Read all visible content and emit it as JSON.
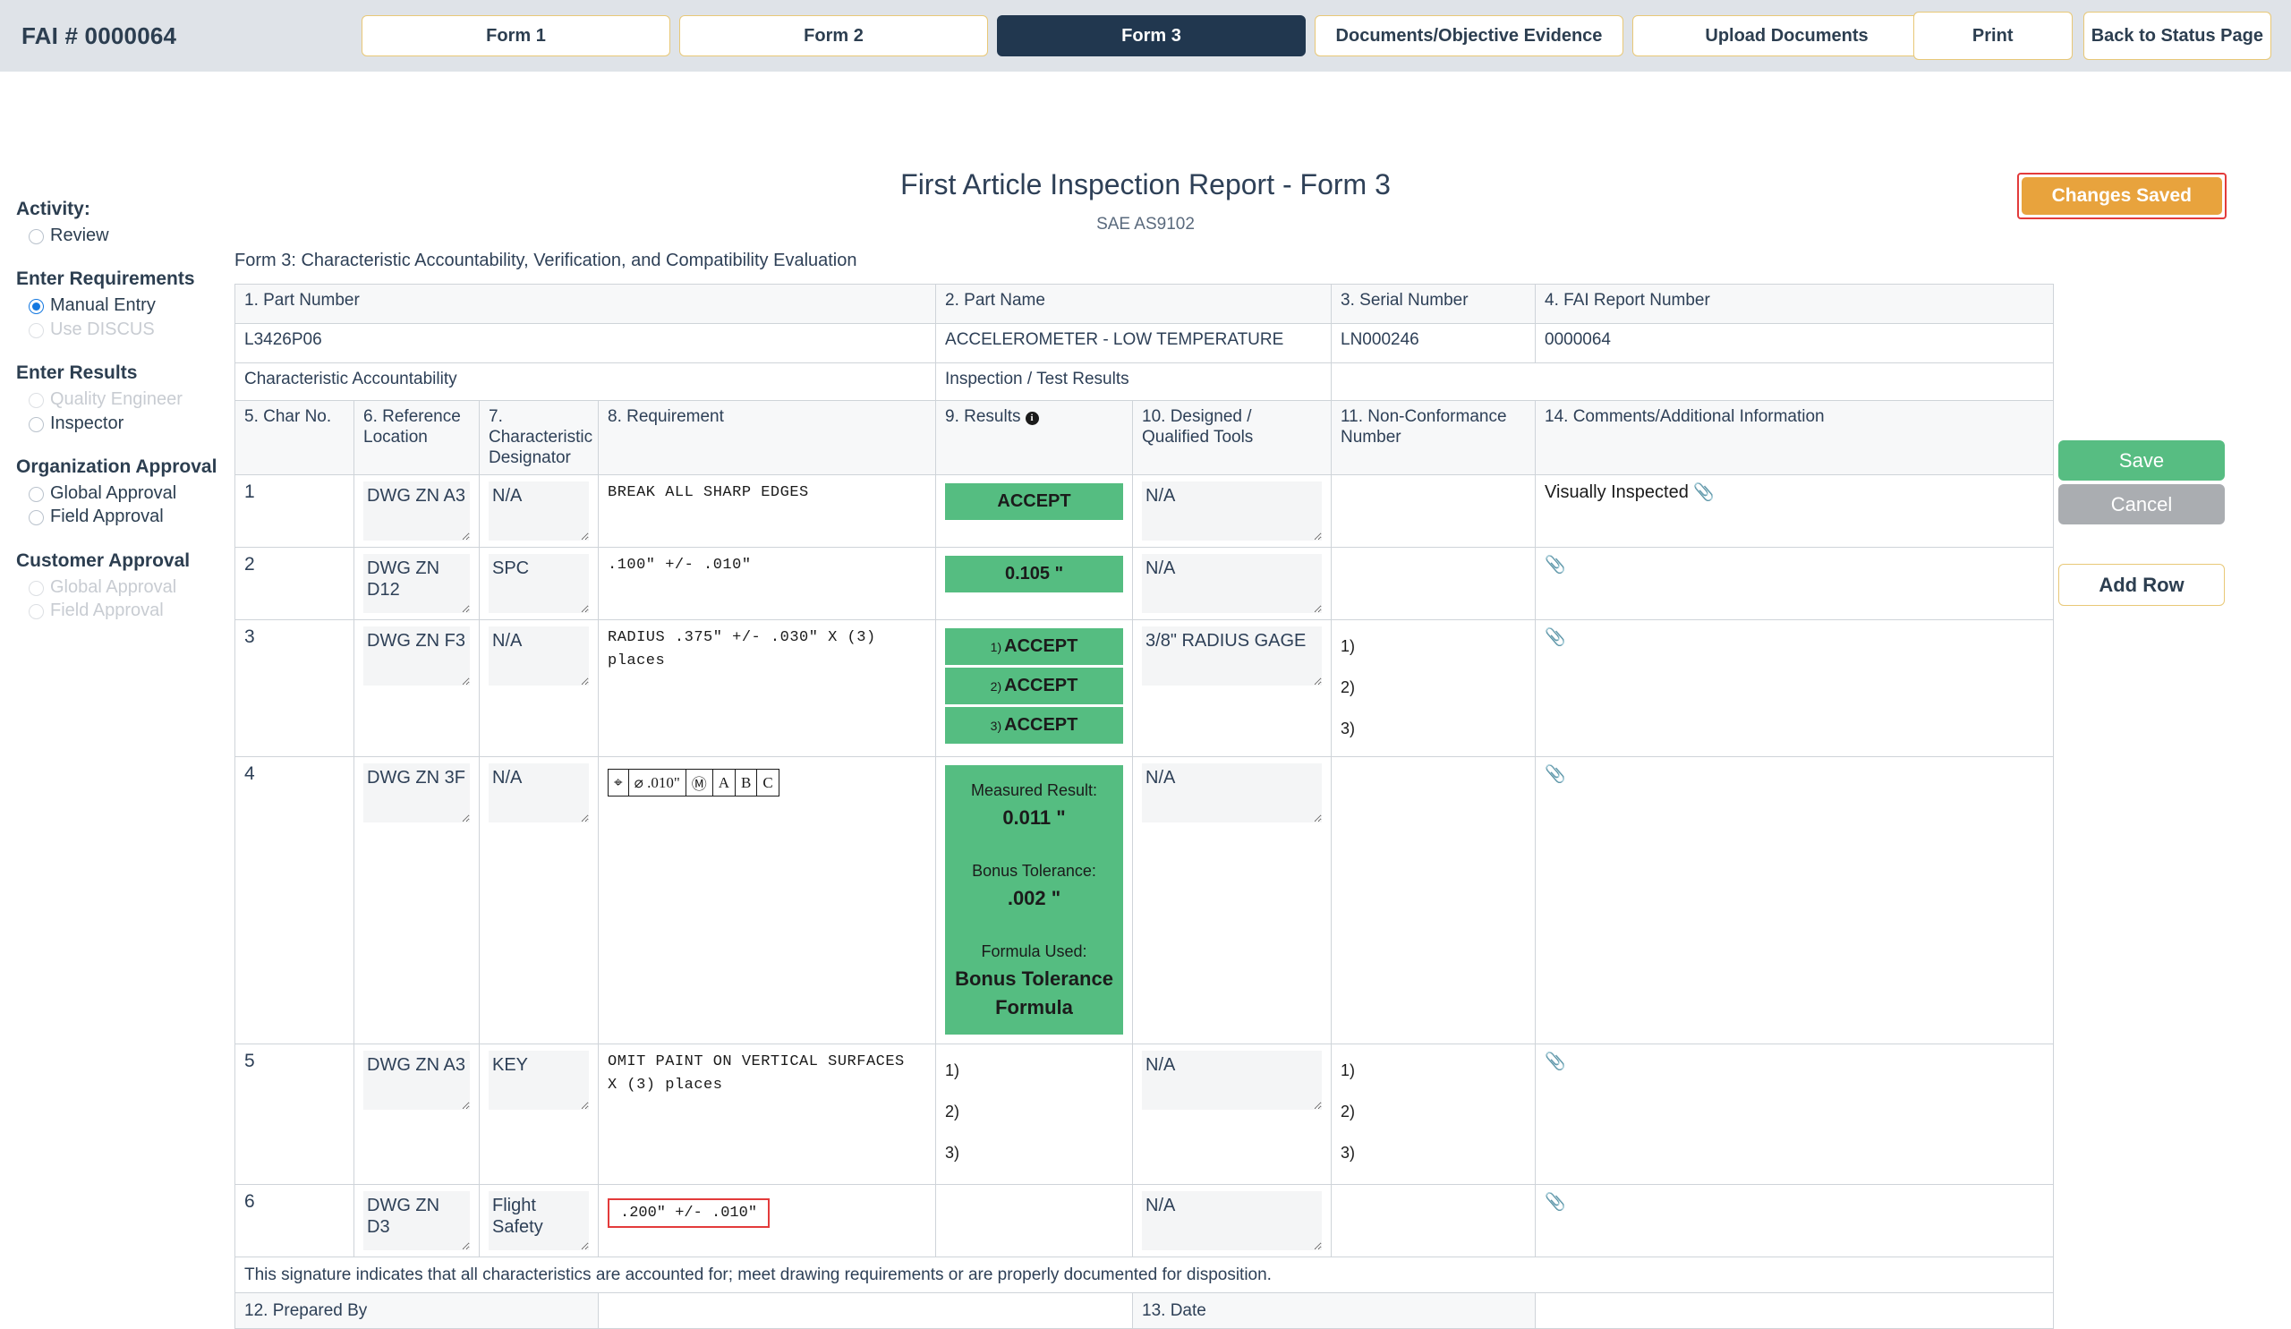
{
  "header": {
    "fai_number": "FAI # 0000064",
    "tabs": [
      {
        "label": "Form 1",
        "active": false
      },
      {
        "label": "Form 2",
        "active": false
      },
      {
        "label": "Form 3",
        "active": true
      },
      {
        "label": "Documents/Objective Evidence",
        "active": false
      },
      {
        "label": "Upload Documents",
        "active": false
      }
    ],
    "print_label": "Print",
    "back_label": "Back to Status Page"
  },
  "sidebar": {
    "activity_label": "Activity:",
    "review_label": "Review",
    "groups": [
      {
        "title": "Enter Requirements",
        "options": [
          {
            "label": "Manual Entry",
            "checked": true,
            "disabled": false
          },
          {
            "label": "Use DISCUS",
            "checked": false,
            "disabled": true
          }
        ]
      },
      {
        "title": "Enter Results",
        "options": [
          {
            "label": "Quality Engineer",
            "checked": false,
            "disabled": true
          },
          {
            "label": "Inspector",
            "checked": false,
            "disabled": false
          }
        ]
      },
      {
        "title": "Organization Approval",
        "options": [
          {
            "label": "Global Approval",
            "checked": false,
            "disabled": false
          },
          {
            "label": "Field Approval",
            "checked": false,
            "disabled": false
          }
        ]
      },
      {
        "title": "Customer Approval",
        "options": [
          {
            "label": "Global Approval",
            "checked": false,
            "disabled": true
          },
          {
            "label": "Field Approval",
            "checked": false,
            "disabled": true
          }
        ]
      }
    ]
  },
  "page": {
    "title": "First Article Inspection Report - Form 3",
    "subtitle": "SAE AS9102",
    "changes_saved_label": "Changes Saved",
    "form_caption": "Form 3: Characteristic Accountability, Verification, and Compatibility Evaluation"
  },
  "actions": {
    "save_label": "Save",
    "cancel_label": "Cancel",
    "add_row_label": "Add Row"
  },
  "table": {
    "top_headers": {
      "part_number": "1. Part Number",
      "part_name": "2. Part Name",
      "serial_number": "3. Serial Number",
      "fai_report_number": "4. FAI Report Number"
    },
    "top_values": {
      "part_number": "L3426P06",
      "part_name": "ACCELEROMETER - LOW TEMPERATURE",
      "serial_number": "LN000246",
      "fai_report_number": "0000064"
    },
    "group_headers": {
      "accountability": "Characteristic Accountability",
      "results": "Inspection / Test Results",
      "blank": ""
    },
    "columns": {
      "char_no": "5. Char No.",
      "reference_location": "6. Reference Location",
      "characteristic_designator": "7. Characteristic Designator",
      "requirement": "8. Requirement",
      "results": "9. Results",
      "results_icon": "info-icon",
      "tools": "10. Designed / Qualified Tools",
      "nonconformance": "11. Non-Conformance Number",
      "comments": "14. Comments/Additional Information"
    },
    "rows": [
      {
        "char_no": "1",
        "reference_location": "DWG ZN A3",
        "designator": "N/A",
        "requirement": "BREAK  ALL  SHARP  EDGES",
        "results_type": "pill",
        "results": [
          {
            "label": "ACCEPT",
            "index": ""
          }
        ],
        "tools": "N/A",
        "nonconformance": "",
        "comments": "Visually Inspected"
      },
      {
        "char_no": "2",
        "reference_location": "DWG ZN D12",
        "designator": "SPC",
        "requirement": ".100\"  +/-  .010\"",
        "results_type": "pill",
        "results": [
          {
            "label": "0.105 \"",
            "index": ""
          }
        ],
        "tools": "N/A",
        "nonconformance": "",
        "comments": ""
      },
      {
        "char_no": "3",
        "reference_location": "DWG ZN F3",
        "designator": "N/A",
        "requirement": "RADIUS  .375\"  +/- .030\"  X  (3)  places",
        "results_type": "pill-multi",
        "results": [
          {
            "label": "ACCEPT",
            "index": "1)"
          },
          {
            "label": "ACCEPT",
            "index": "2)"
          },
          {
            "label": "ACCEPT",
            "index": "3)"
          }
        ],
        "tools": "3/8\" RADIUS GAGE",
        "nonconformance": [
          "1)",
          "2)",
          "3)"
        ],
        "comments": ""
      },
      {
        "char_no": "4",
        "reference_location": "DWG ZN 3F",
        "designator": "N/A",
        "requirement_gdt": [
          "⌖",
          "⌀ .010\"",
          "Ⓜ",
          "A",
          "B",
          "C"
        ],
        "results_type": "block",
        "results_block": {
          "measured_label": "Measured Result:",
          "measured_value": "0.011 \"",
          "bonus_label": "Bonus Tolerance:",
          "bonus_value": ".002 \"",
          "formula_label": "Formula Used:",
          "formula_value": "Bonus Tolerance Formula"
        },
        "tools": "N/A",
        "nonconformance": "",
        "comments": ""
      },
      {
        "char_no": "5",
        "reference_location": "DWG ZN A3",
        "designator": "KEY",
        "requirement": "OMIT  PAINT  ON  VERTICAL  SURFACES\nX  (3)  places",
        "results_type": "numlist",
        "results_list": [
          "1)",
          "2)",
          "3)"
        ],
        "tools": "N/A",
        "nonconformance": [
          "1)",
          "2)",
          "3)"
        ],
        "comments": ""
      },
      {
        "char_no": "6",
        "reference_location": "DWG ZN D3",
        "designator": "Flight Safety",
        "requirement_boxed": ".200\"  +/-  .010\"",
        "results_type": "empty",
        "tools": "N/A",
        "nonconformance": "",
        "comments": ""
      }
    ],
    "signature_note": "This signature indicates that all characteristics are accounted for; meet drawing requirements or are properly documented for disposition.",
    "prepared_by": "12. Prepared By",
    "date": "13. Date"
  }
}
